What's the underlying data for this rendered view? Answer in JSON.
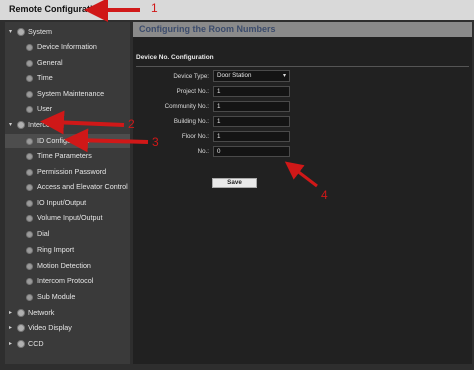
{
  "window": {
    "title": "Remote Configuration"
  },
  "sidebar": {
    "items": [
      {
        "label": "System",
        "level": 0,
        "expanded": true,
        "icon": "settings-icon"
      },
      {
        "label": "Device Information",
        "level": 1,
        "icon": "gear-icon"
      },
      {
        "label": "General",
        "level": 1,
        "icon": "gear-icon"
      },
      {
        "label": "Time",
        "level": 1,
        "icon": "gear-icon"
      },
      {
        "label": "System Maintenance",
        "level": 1,
        "icon": "gear-icon"
      },
      {
        "label": "User",
        "level": 1,
        "icon": "gear-icon"
      },
      {
        "label": "Intercom",
        "level": 0,
        "expanded": true,
        "icon": "settings-icon"
      },
      {
        "label": "ID Configuration",
        "level": 1,
        "selected": true,
        "icon": "gear-icon"
      },
      {
        "label": "Time Parameters",
        "level": 1,
        "icon": "gear-icon"
      },
      {
        "label": "Permission Password",
        "level": 1,
        "icon": "gear-icon"
      },
      {
        "label": "Access and Elevator Control",
        "level": 1,
        "icon": "gear-icon"
      },
      {
        "label": "IO Input/Output",
        "level": 1,
        "icon": "gear-icon"
      },
      {
        "label": "Volume Input/Output",
        "level": 1,
        "icon": "gear-icon"
      },
      {
        "label": "Dial",
        "level": 1,
        "icon": "gear-icon"
      },
      {
        "label": "Ring Import",
        "level": 1,
        "icon": "gear-icon"
      },
      {
        "label": "Motion Detection",
        "level": 1,
        "icon": "gear-icon"
      },
      {
        "label": "Intercom Protocol",
        "level": 1,
        "icon": "gear-icon"
      },
      {
        "label": "Sub Module",
        "level": 1,
        "icon": "gear-icon"
      },
      {
        "label": "Network",
        "level": 0,
        "expanded": false,
        "icon": "settings-icon"
      },
      {
        "label": "Video Display",
        "level": 0,
        "expanded": false,
        "icon": "settings-icon"
      },
      {
        "label": "CCD",
        "level": 0,
        "expanded": false,
        "icon": "settings-icon"
      }
    ]
  },
  "main": {
    "title": "Configuring the Room Numbers",
    "section": "Device No. Configuration",
    "fields": {
      "device_type": {
        "label": "Device Type:",
        "value": "Door Station"
      },
      "project_no": {
        "label": "Project No.:",
        "value": "1"
      },
      "community_no": {
        "label": "Community No.:",
        "value": "1"
      },
      "building_no": {
        "label": "Building No.:",
        "value": "1"
      },
      "floor_no": {
        "label": "Floor No.:",
        "value": "1"
      },
      "no": {
        "label": "No.:",
        "value": "0"
      }
    },
    "save_label": "Save"
  },
  "annotations": [
    "1",
    "2",
    "3",
    "4"
  ],
  "colors": {
    "annotation": "#d01818",
    "title_bar": "#8a8a8a",
    "title_text": "#3c4c6c"
  }
}
